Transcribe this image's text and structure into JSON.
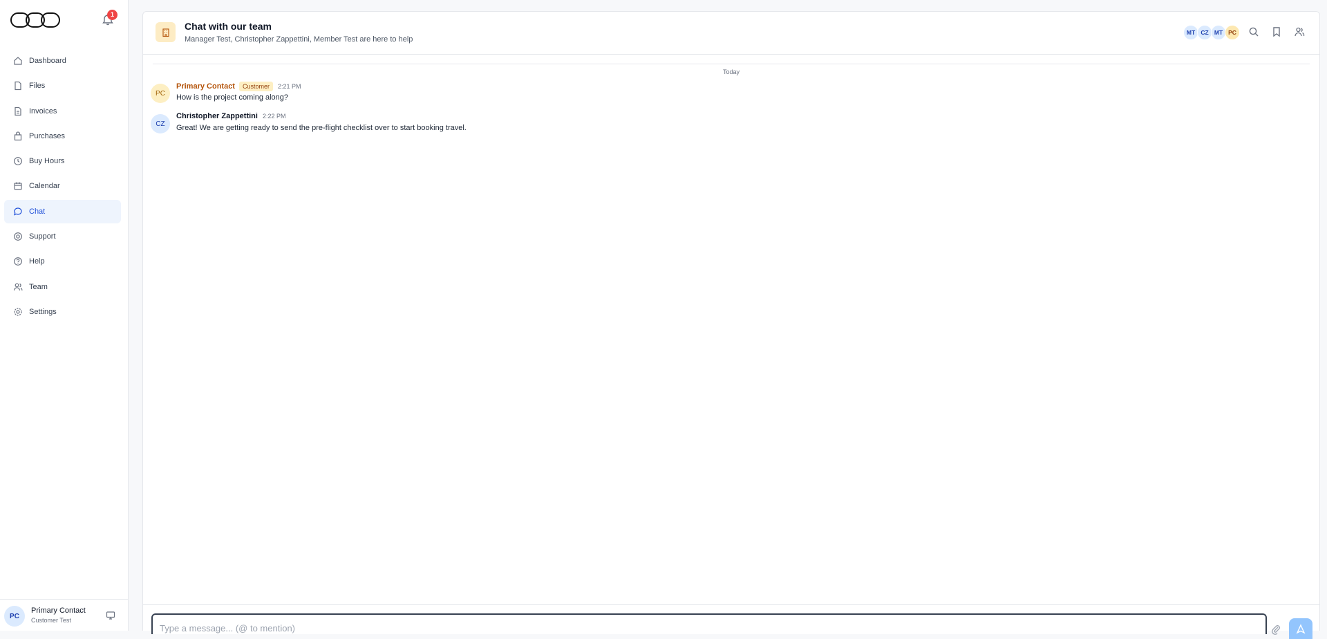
{
  "notifications": {
    "count": "1"
  },
  "sidebar": {
    "items": [
      {
        "label": "Dashboard",
        "icon": "home-icon"
      },
      {
        "label": "Files",
        "icon": "file-icon"
      },
      {
        "label": "Invoices",
        "icon": "invoice-icon"
      },
      {
        "label": "Purchases",
        "icon": "shopping-bag-icon"
      },
      {
        "label": "Buy Hours",
        "icon": "clock-icon"
      },
      {
        "label": "Calendar",
        "icon": "calendar-icon"
      },
      {
        "label": "Chat",
        "icon": "chat-icon",
        "active": true
      },
      {
        "label": "Support",
        "icon": "lifebuoy-icon"
      },
      {
        "label": "Help",
        "icon": "help-circle-icon"
      },
      {
        "label": "Team",
        "icon": "team-icon"
      },
      {
        "label": "Settings",
        "icon": "gear-icon"
      }
    ],
    "user": {
      "initials": "PC",
      "name": "Primary Contact",
      "subtitle": "Customer Test"
    }
  },
  "header": {
    "title": "Chat with our team",
    "subtitle": "Manager Test, Christopher Zappettini, Member Test are here to help",
    "members": [
      "MT",
      "CZ",
      "MT",
      "PC"
    ]
  },
  "chat": {
    "day_label": "Today",
    "messages": [
      {
        "initials": "PC",
        "name": "Primary Contact",
        "tag": "Customer",
        "time": "2:21 PM",
        "text": "How is the project coming along?"
      },
      {
        "initials": "CZ",
        "name": "Christopher Zappettini",
        "tag": "",
        "time": "2:22 PM",
        "text": "Great! We are getting ready to send the pre-flight checklist over to start booking travel."
      }
    ]
  },
  "composer": {
    "placeholder": "Type a message... (@ to mention)"
  },
  "colors": {
    "accent": "#1d4ed8",
    "active_bg": "#eef4fd",
    "badge": "#ef4444",
    "customer": "#b45309"
  }
}
